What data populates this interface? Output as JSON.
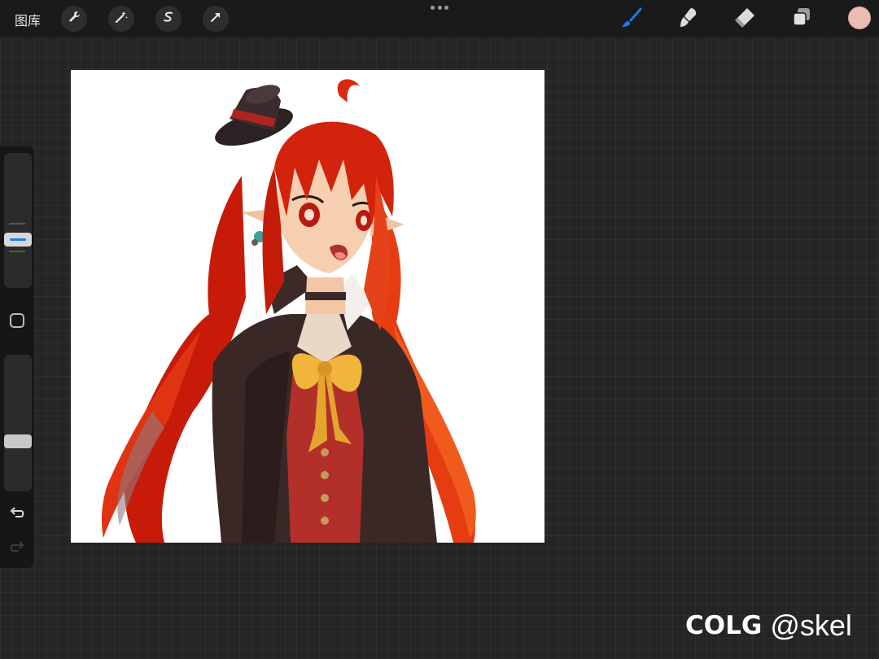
{
  "top_bar": {
    "gallery_label": "图库",
    "left_tools": [
      {
        "name": "actions",
        "icon": "wrench-icon"
      },
      {
        "name": "adjustments",
        "icon": "magic-wand-icon"
      },
      {
        "name": "selection",
        "icon": "selection-s-icon"
      },
      {
        "name": "transform",
        "icon": "arrow-cursor-icon"
      }
    ],
    "right_tools": [
      {
        "name": "brush",
        "icon": "brush-icon",
        "active": true
      },
      {
        "name": "smudge",
        "icon": "smudge-icon",
        "active": false
      },
      {
        "name": "eraser",
        "icon": "eraser-icon",
        "active": false
      },
      {
        "name": "layers",
        "icon": "layers-icon",
        "active": false
      }
    ],
    "current_color": "#ebbcb4",
    "accent_color": "#1c7cf2"
  },
  "sidebar": {
    "brush_size": {
      "icon": "brush-size-slider"
    },
    "modify_button": {
      "icon": "square-icon"
    },
    "opacity": {
      "icon": "opacity-slider"
    },
    "undo": {
      "icon": "undo-icon"
    },
    "redo": {
      "icon": "redo-icon",
      "enabled": false
    }
  },
  "watermark": {
    "logo_text": "COLG",
    "username": "@skel"
  }
}
